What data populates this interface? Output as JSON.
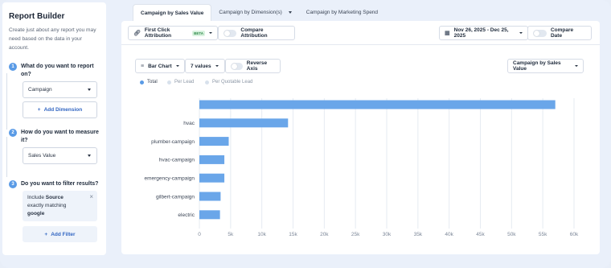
{
  "sidebar": {
    "title": "Report Builder",
    "description": "Create just about any report you may need based on the data in your account.",
    "steps": [
      {
        "num": "1",
        "question": "What do you want to report on?",
        "select_value": "Campaign",
        "button_label": "Add Dimension"
      },
      {
        "num": "2",
        "question": "How do you want to measure it?",
        "select_value": "Sales Value"
      },
      {
        "num": "3",
        "question": "Do you want to filter results?",
        "filter": {
          "include": "Include",
          "field": "Source",
          "match": "exactly matching",
          "value": "google"
        },
        "button_label": "Add Filter"
      }
    ]
  },
  "tabs": [
    {
      "label": "Campaign by Sales Value",
      "active": true
    },
    {
      "label": "Campaign by Dimension(s)",
      "active": false,
      "has_caret": true
    },
    {
      "label": "Campaign by Marketing Spend",
      "active": false
    }
  ],
  "toolbar": {
    "attribution_label": "First Click Attribution",
    "attribution_badge": "BETA",
    "compare_attribution_label": "Compare Attribution",
    "date_range": "Nov 26, 2025 - Dec 25, 2025",
    "compare_date_label": "Compare Date"
  },
  "chart_controls": {
    "chart_type": "Bar Chart",
    "values_count": "7 values",
    "reverse_axis_label": "Reverse Axis",
    "metric_select": "Campaign by Sales Value"
  },
  "legend": [
    {
      "label": "Total",
      "color": "#5a9be6"
    },
    {
      "label": "Per Lead",
      "color": "#d8e1ec"
    },
    {
      "label": "Per Quotable Lead",
      "color": "#d8e1ec"
    }
  ],
  "colors": {
    "accent": "#5a9be6",
    "bar": "#6aa6e9",
    "link": "#3266c2"
  },
  "chart_data": {
    "type": "bar",
    "orientation": "horizontal",
    "categories": [
      "",
      "hvac",
      "plumber-campaign",
      "hvac-campaign",
      "emergency-campaign",
      "gilbert-campaign",
      "electric"
    ],
    "values": [
      57000,
      14200,
      4700,
      4000,
      4000,
      3400,
      3300
    ],
    "xlim": [
      0,
      60000
    ],
    "x_ticks": [
      "0",
      "5k",
      "10k",
      "15k",
      "20k",
      "25k",
      "30k",
      "35k",
      "40k",
      "45k",
      "50k",
      "55k",
      "60k"
    ],
    "grid": true
  }
}
